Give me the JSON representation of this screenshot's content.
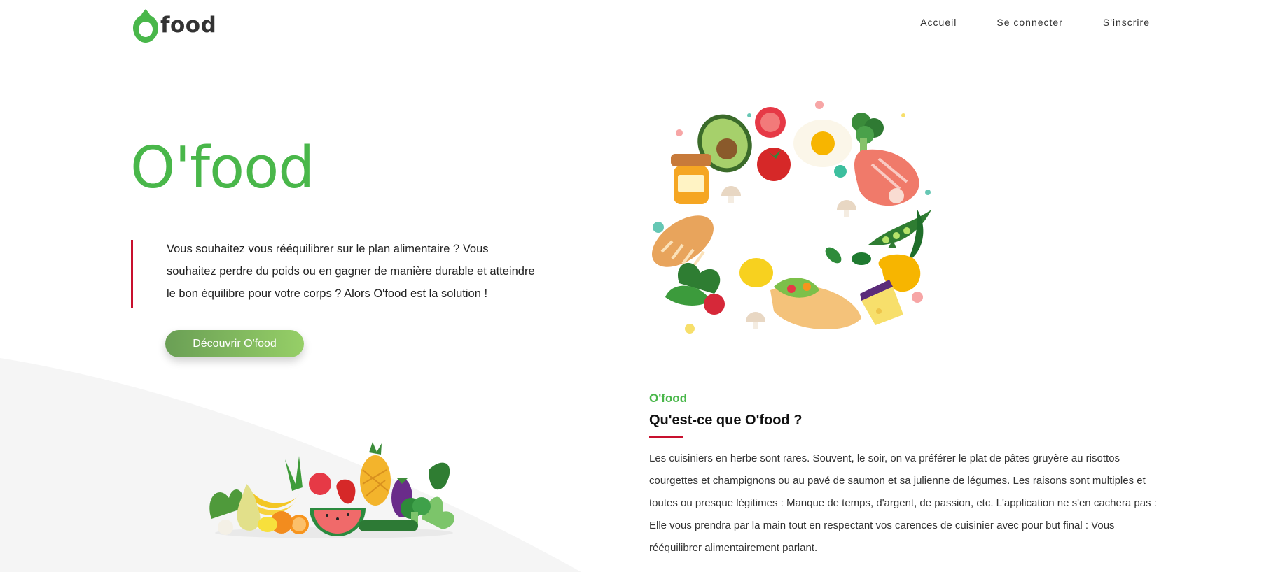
{
  "app": {
    "logo_text": "food",
    "logo_icon": "o-leaf-icon",
    "brand_color": "#49b74a",
    "accent_color": "#c8102e"
  },
  "nav": {
    "items": [
      {
        "label": "Accueil"
      },
      {
        "label": "Se connecter"
      },
      {
        "label": "S'inscrire"
      }
    ]
  },
  "hero": {
    "title": "O'food",
    "intro": "Vous souhaitez vous rééquilibrer sur le plan alimentaire ? Vous souhaitez perdre du poids ou en gagner de manière durable et atteindre le bon équilibre pour votre corps ? Alors O'food est la solution !",
    "cta_label": "Découvrir O'food"
  },
  "illustrations": {
    "food_ring": "food-ring-illustration",
    "vegetables": "vegetable-pile-illustration"
  },
  "about": {
    "kicker": "O'food",
    "title": "Qu'est-ce que O'food ?",
    "body": "Les cuisiniers en herbe sont rares. Souvent, le soir, on va préférer le plat de pâtes gruyère au risottos courgettes et champignons ou au pavé de saumon et sa julienne de légumes. Les raisons sont multiples et toutes ou presque légitimes : Manque de temps, d'argent, de passion, etc. L'application ne s'en cachera pas : Elle vous prendra par la main tout en respectant vos carences de cuisinier avec pour but final : Vous rééquilibrer alimentairement parlant."
  }
}
